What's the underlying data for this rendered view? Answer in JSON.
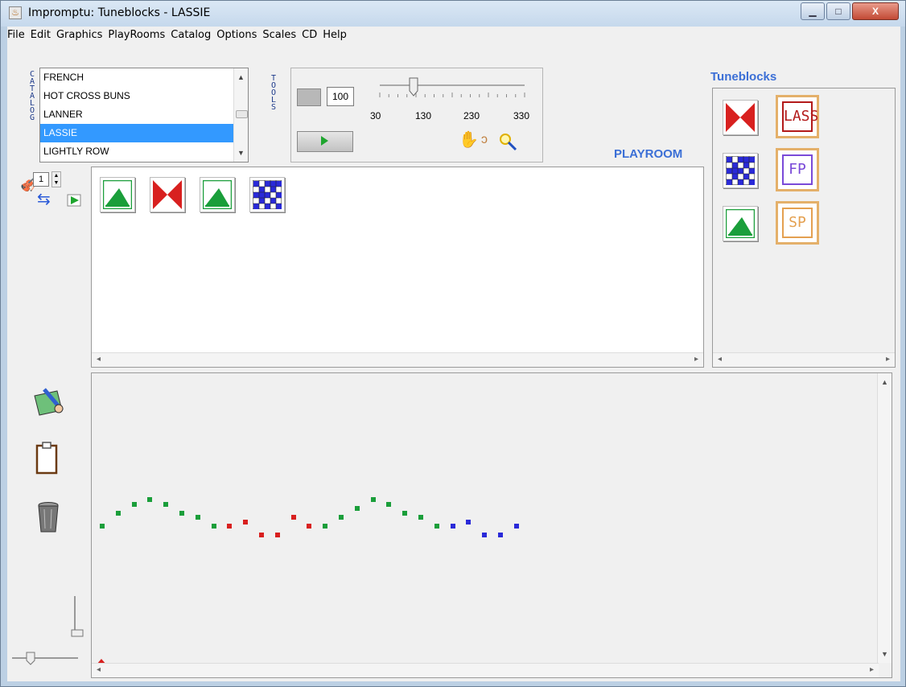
{
  "window": {
    "title": "Impromptu: Tuneblocks - LASSIE"
  },
  "menu": [
    "File",
    "Edit",
    "Graphics",
    "PlayRooms",
    "Catalog",
    "Options",
    "Scales",
    "CD",
    "Help"
  ],
  "catalog": {
    "label": "CATALOG",
    "items": [
      "FRENCH",
      "HOT CROSS BUNS",
      "LANNER",
      "LASSIE",
      "LIGHTLY ROW"
    ],
    "selected": "LASSIE"
  },
  "tools_label": "TOOLS",
  "tempo": {
    "value": "100",
    "ticks": [
      "30",
      "130",
      "230",
      "330"
    ],
    "level": 100
  },
  "playroom": {
    "label": "PLAYROOM",
    "repeat_value": "1",
    "blocks": [
      "green-triangle",
      "red-hourglass",
      "green-triangle",
      "blue-grid"
    ]
  },
  "tuneblocks": {
    "title": "Tuneblocks",
    "blocks": [
      "red-hourglass",
      "blue-grid",
      "green-triangle"
    ],
    "tunes": [
      "LASS",
      "FP",
      "SP"
    ]
  },
  "notes": [
    {
      "x": 0,
      "y": 2,
      "color": "green"
    },
    {
      "x": 1,
      "y": 5,
      "color": "green"
    },
    {
      "x": 2,
      "y": 7,
      "color": "green"
    },
    {
      "x": 3,
      "y": 8,
      "color": "green"
    },
    {
      "x": 4,
      "y": 7,
      "color": "green"
    },
    {
      "x": 5,
      "y": 5,
      "color": "green"
    },
    {
      "x": 6,
      "y": 4,
      "color": "green"
    },
    {
      "x": 7,
      "y": 2,
      "color": "green"
    },
    {
      "x": 8,
      "y": 2,
      "color": "red"
    },
    {
      "x": 9,
      "y": 3,
      "color": "red"
    },
    {
      "x": 10,
      "y": 0,
      "color": "red"
    },
    {
      "x": 11,
      "y": 0,
      "color": "red"
    },
    {
      "x": 12,
      "y": 4,
      "color": "red"
    },
    {
      "x": 13,
      "y": 2,
      "color": "red"
    },
    {
      "x": 14,
      "y": 2,
      "color": "green"
    },
    {
      "x": 15,
      "y": 4,
      "color": "green"
    },
    {
      "x": 16,
      "y": 6,
      "color": "green"
    },
    {
      "x": 17,
      "y": 8,
      "color": "green"
    },
    {
      "x": 18,
      "y": 7,
      "color": "green"
    },
    {
      "x": 19,
      "y": 5,
      "color": "green"
    },
    {
      "x": 20,
      "y": 4,
      "color": "green"
    },
    {
      "x": 21,
      "y": 2,
      "color": "green"
    },
    {
      "x": 22,
      "y": 2,
      "color": "blue"
    },
    {
      "x": 23,
      "y": 3,
      "color": "blue"
    },
    {
      "x": 24,
      "y": 0,
      "color": "blue"
    },
    {
      "x": 25,
      "y": 0,
      "color": "blue"
    },
    {
      "x": 26,
      "y": 2,
      "color": "blue"
    }
  ],
  "colors": {
    "green": "#1a9e3a",
    "red": "#d8201f",
    "blue": "#2a2ad8",
    "accent": "#3b6fd6",
    "selection": "#3399ff"
  }
}
